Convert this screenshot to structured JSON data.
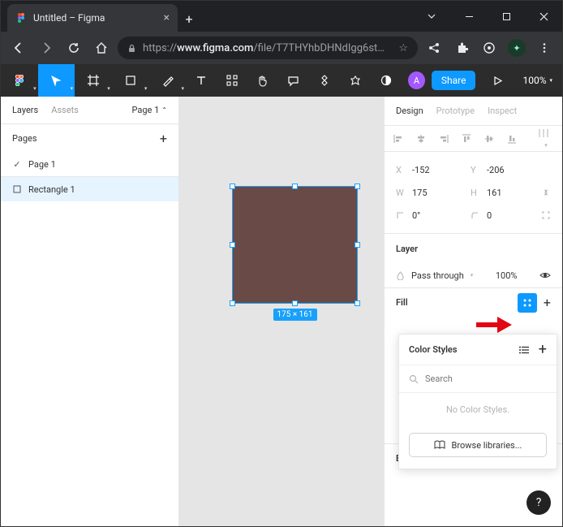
{
  "browser": {
    "tab_title": "Untitled – Figma",
    "url_prefix": "https://",
    "url_host": "www.figma.com",
    "url_path": "/file/T7THYhbDHNdIgg6stMqLjp/..."
  },
  "toolbar": {
    "share_label": "Share",
    "zoom": "100%",
    "avatar_initial": "A"
  },
  "left_panel": {
    "tab_layers": "Layers",
    "tab_assets": "Assets",
    "page_selector": "Page 1",
    "pages_header": "Pages",
    "pages": [
      "Page 1"
    ],
    "layers": [
      "Rectangle 1"
    ]
  },
  "canvas": {
    "dimension_label": "175 × 161"
  },
  "right_panel": {
    "tab_design": "Design",
    "tab_prototype": "Prototype",
    "tab_inspect": "Inspect",
    "x_label": "X",
    "x_value": "-152",
    "y_label": "Y",
    "y_value": "-206",
    "w_label": "W",
    "w_value": "175",
    "h_label": "H",
    "h_value": "161",
    "rot_value": "0°",
    "corner_value": "0",
    "layer_header": "Layer",
    "blend_mode": "Pass through",
    "opacity": "100%",
    "fill_header": "Fill",
    "export_header": "Export"
  },
  "color_styles": {
    "title": "Color Styles",
    "search_placeholder": "Search",
    "empty_text": "No Color Styles.",
    "browse_label": "Browse libraries..."
  }
}
